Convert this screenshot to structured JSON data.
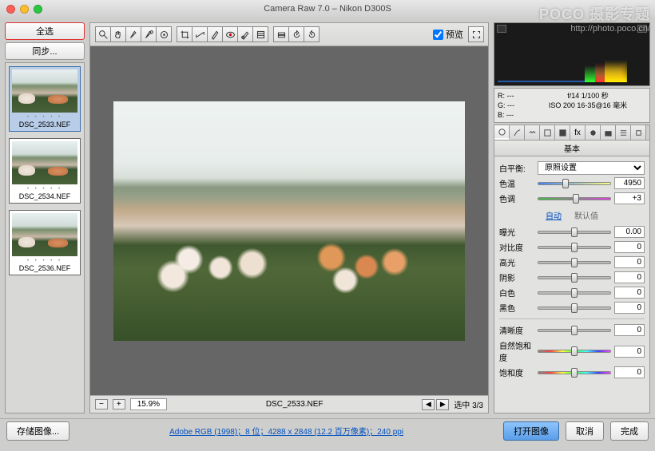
{
  "window": {
    "title": "Camera Raw 7.0 – Nikon D300S"
  },
  "watermark": {
    "brand": "POCO 摄影专题",
    "url": "http://photo.poco.cn/"
  },
  "filmstrip": {
    "select_all": "全选",
    "sync": "同步...",
    "thumbs": [
      {
        "name": "DSC_2533.NEF",
        "selected": true
      },
      {
        "name": "DSC_2534.NEF",
        "selected": false
      },
      {
        "name": "DSC_2536.NEF",
        "selected": false
      }
    ]
  },
  "toolbar": {
    "preview_label": "预览",
    "preview_checked": true
  },
  "viewer": {
    "zoom": "15.9%",
    "filename": "DSC_2533.NEF",
    "selection": "选中 3/3"
  },
  "exif": {
    "r": "R:  ---",
    "g": "G:  ---",
    "b": "B:  ---",
    "line1": "f/14    1/100 秒",
    "line2": "ISO 200    16-35@16 毫米"
  },
  "panel": {
    "title": "基本",
    "wb_label": "白平衡:",
    "wb_value": "原照设置",
    "auto": "自动",
    "default": "默认值",
    "sliders": {
      "temp": {
        "label": "色温",
        "value": "4950",
        "pos": 38
      },
      "tint": {
        "label": "色调",
        "value": "+3",
        "pos": 52
      },
      "exposure": {
        "label": "曝光",
        "value": "0.00",
        "pos": 50
      },
      "contrast": {
        "label": "对比度",
        "value": "0",
        "pos": 50
      },
      "highlights": {
        "label": "高光",
        "value": "0",
        "pos": 50
      },
      "shadows": {
        "label": "阴影",
        "value": "0",
        "pos": 50
      },
      "whites": {
        "label": "白色",
        "value": "0",
        "pos": 50
      },
      "blacks": {
        "label": "黑色",
        "value": "0",
        "pos": 50
      },
      "clarity": {
        "label": "清晰度",
        "value": "0",
        "pos": 50
      },
      "vibrance": {
        "label": "自然饱和度",
        "value": "0",
        "pos": 50
      },
      "saturation": {
        "label": "饱和度",
        "value": "0",
        "pos": 50
      }
    }
  },
  "footer": {
    "save": "存储图像...",
    "info": "Adobe RGB (1998)；8 位；4288 x 2848 (12.2 百万像素)；240 ppi",
    "open": "打开图像",
    "cancel": "取消",
    "done": "完成"
  }
}
